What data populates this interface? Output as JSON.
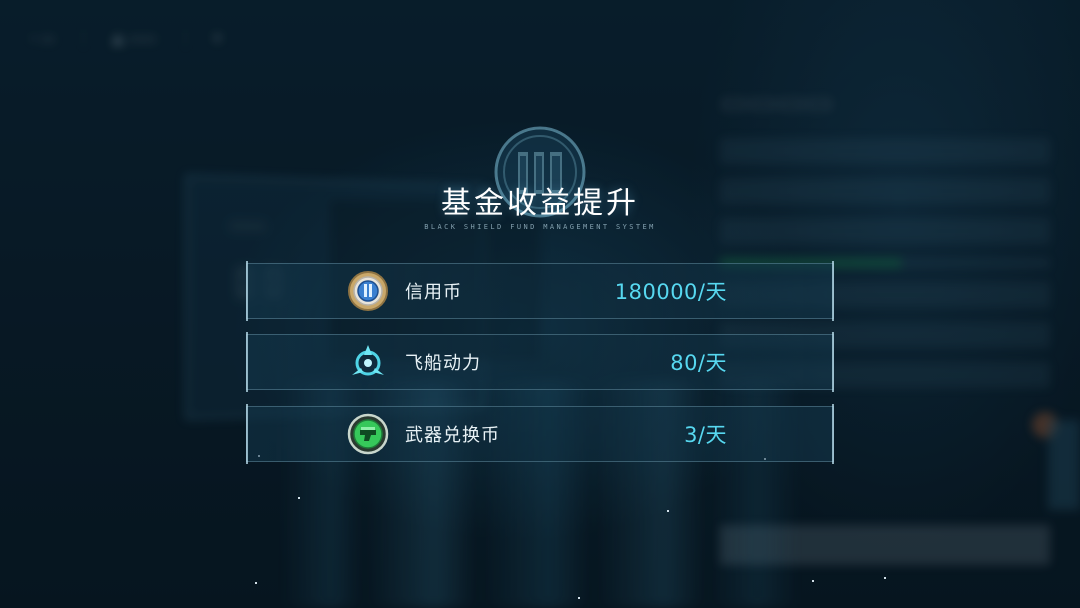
{
  "modal": {
    "title": "基金收益提升",
    "subtitle": "BLACK SHIELD FUND MANAGEMENT SYSTEM",
    "rewards": [
      {
        "label": "信用币",
        "value": "180000/天",
        "icon": "credit-coin-icon"
      },
      {
        "label": "飞船动力",
        "value": "80/天",
        "icon": "ship-power-icon"
      },
      {
        "label": "武器兑换币",
        "value": "3/天",
        "icon": "weapon-exchange-coin-icon"
      }
    ]
  },
  "colors": {
    "value_cyan": "#57d8f0",
    "title_white": "#ffffff",
    "credit_blue": "#3a7fd0",
    "power_cyan": "#4fd4e6",
    "weapon_green": "#36c85a"
  }
}
